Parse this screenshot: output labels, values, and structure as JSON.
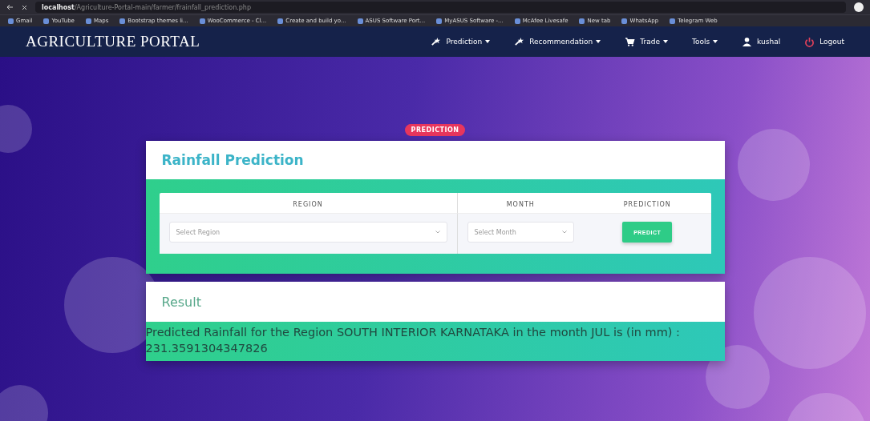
{
  "browser": {
    "url_host": "localhost",
    "url_path": "/Agriculture-Portal-main/farmer/frainfall_prediction.php"
  },
  "bookmarks": [
    "Gmail",
    "YouTube",
    "Maps",
    "Bootstrap themes li...",
    "WooCommerce - Cl...",
    "Create and build yo...",
    "ASUS Software Port...",
    "MyASUS Software -...",
    "McAfee Livesafe",
    "New tab",
    "WhatsApp",
    "Telegram Web"
  ],
  "navbar": {
    "brand": "AGRICULTURE PORTAL",
    "items": [
      {
        "label": "Prediction",
        "kind": "dropdown"
      },
      {
        "label": "Recommendation",
        "kind": "dropdown"
      },
      {
        "label": "Trade",
        "kind": "dropdown"
      },
      {
        "label": "Tools",
        "kind": "dropdown"
      },
      {
        "label": "kushal",
        "kind": "link"
      },
      {
        "label": "Logout",
        "kind": "link"
      }
    ]
  },
  "badge": "PREDICTION",
  "prediction_card": {
    "title": "Rainfall Prediction",
    "columns": [
      "REGION",
      "MONTH",
      "PREDICTION"
    ],
    "region": {
      "placeholder": "Select Region"
    },
    "month": {
      "placeholder": "Select Month"
    },
    "button": "PREDICT"
  },
  "result_card": {
    "title": "Result",
    "text": "Predicted Rainfall for the Region SOUTH INTERIOR KARNATAKA in the month JUL is (in mm) : 231.3591304347826"
  }
}
